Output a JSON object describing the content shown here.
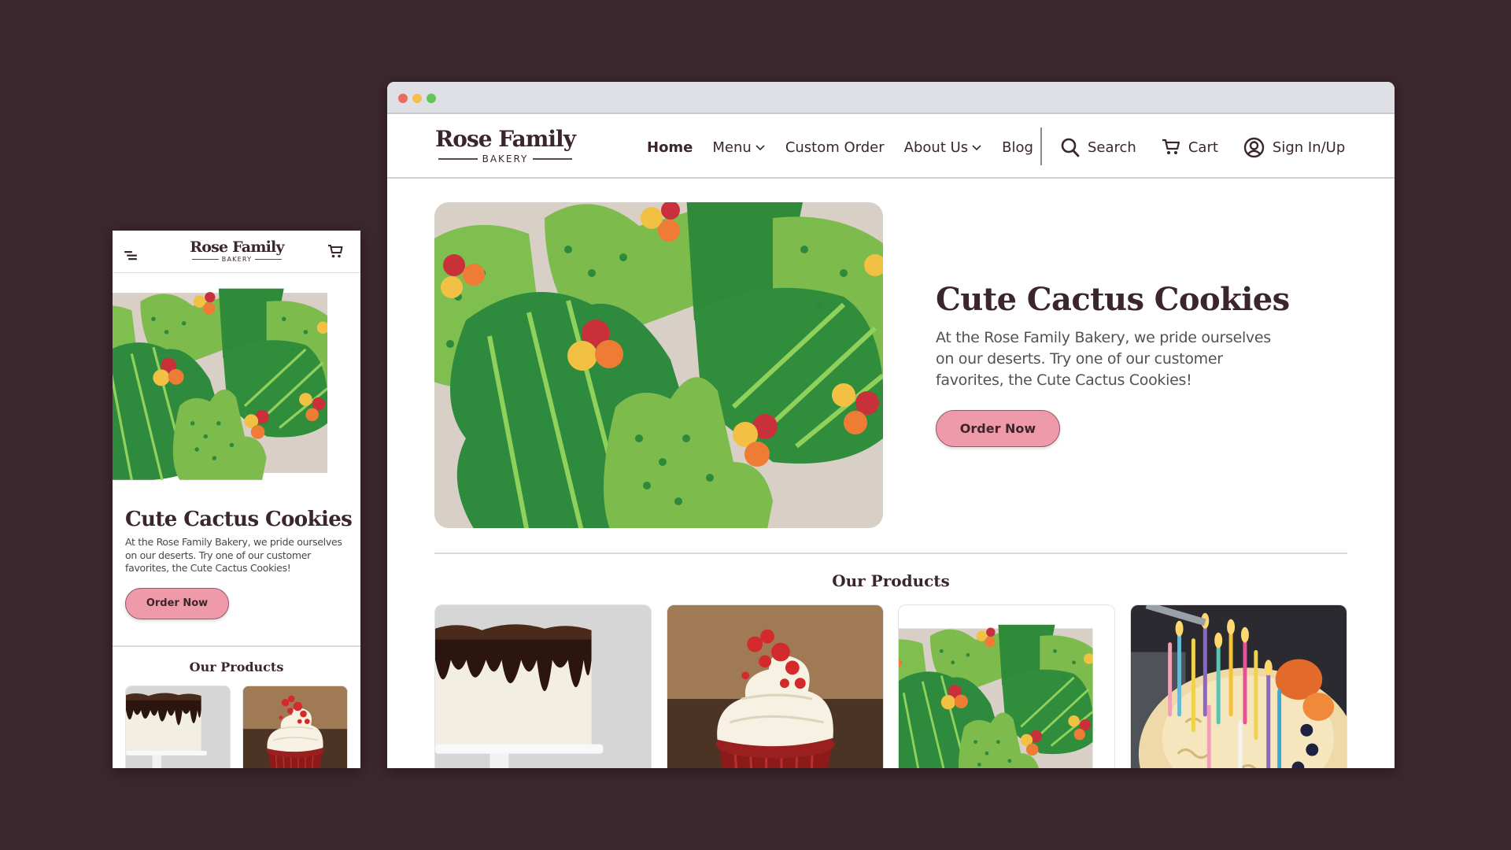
{
  "colors": {
    "background": "#3b272d",
    "brand_text": "#3b262c",
    "button_pink": "#ef9aab",
    "window_dot_close": "#ee6a5e",
    "window_dot_minimize": "#f5be4f",
    "window_dot_maximize": "#62c554"
  },
  "brand": {
    "name": "Rose Family",
    "tagline": "BAKERY"
  },
  "desktop": {
    "nav": {
      "links": [
        {
          "label": "Home",
          "active": true,
          "dropdown": false
        },
        {
          "label": "Menu",
          "active": false,
          "dropdown": true
        },
        {
          "label": "Custom Order",
          "active": false,
          "dropdown": false
        },
        {
          "label": "About Us",
          "active": false,
          "dropdown": true
        },
        {
          "label": "Blog",
          "active": false,
          "dropdown": false
        }
      ],
      "tools": [
        {
          "label": "Search",
          "icon": "search-icon"
        },
        {
          "label": "Cart",
          "icon": "cart-icon"
        },
        {
          "label": "Sign In/Up",
          "icon": "user-circle-icon"
        }
      ]
    },
    "hero": {
      "title": "Cute Cactus Cookies",
      "text": "At the Rose Family Bakery, we pride ourselves on our deserts. Try one of our customer favorites, the Cute Cactus Cookies!",
      "button": "Order Now",
      "image": "cactus-cookies-photo"
    },
    "products": {
      "title": "Our Products",
      "items": [
        {
          "image": "chocolate-drip-cake-photo"
        },
        {
          "image": "red-velvet-cupcake-photo"
        },
        {
          "image": "cactus-cookies-photo"
        },
        {
          "image": "birthday-cake-candles-photo"
        }
      ]
    }
  },
  "mobile": {
    "header": {
      "menu_icon": "menu-icon",
      "cart_icon": "cart-icon"
    },
    "hero": {
      "title": "Cute Cactus Cookies",
      "text": "At the Rose Family Bakery, we pride ourselves on our deserts. Try one of our customer favorites, the Cute Cactus Cookies!",
      "button": "Order Now",
      "image": "cactus-cookies-photo"
    },
    "products": {
      "title": "Our Products",
      "items": [
        {
          "image": "chocolate-drip-cake-photo"
        },
        {
          "image": "red-velvet-cupcake-photo"
        }
      ]
    }
  }
}
